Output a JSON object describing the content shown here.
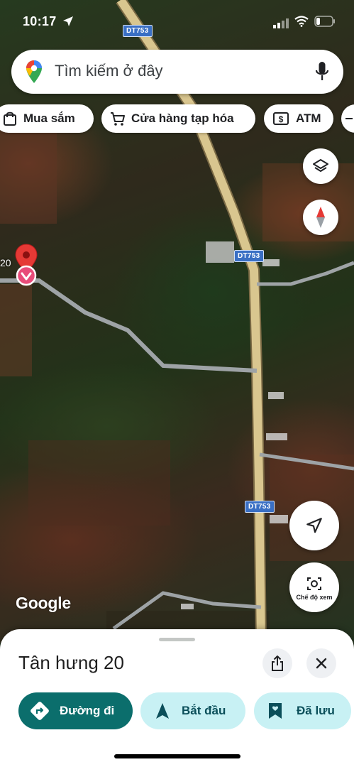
{
  "status_bar": {
    "time": "10:17"
  },
  "search": {
    "placeholder": "Tìm kiếm ở đây"
  },
  "chips": [
    {
      "label": "Mua sắm",
      "icon": "shopping-bag-icon"
    },
    {
      "label": "Cửa hàng tạp hóa",
      "icon": "shopping-cart-icon"
    },
    {
      "label": "ATM",
      "icon": "atm-icon"
    }
  ],
  "map": {
    "road_labels": [
      "DT753",
      "DT753",
      "DT753"
    ],
    "pin_label": "20",
    "attribution": "Google",
    "street_view_label": "Chế độ xem",
    "colors": {
      "highway": "#d9c68f",
      "road": "#9ea3a6",
      "pin": "#e53935"
    }
  },
  "place": {
    "title": "Tân hưng 20"
  },
  "actions": {
    "directions": "Đường đi",
    "start": "Bắt đầu",
    "saved": "Đã lưu"
  },
  "colors": {
    "directions_bg": "#0b6e6c",
    "start_bg": "#c8f1f4",
    "saved_bg": "#c8f1f4",
    "primary_text": "#0b4f5a"
  }
}
